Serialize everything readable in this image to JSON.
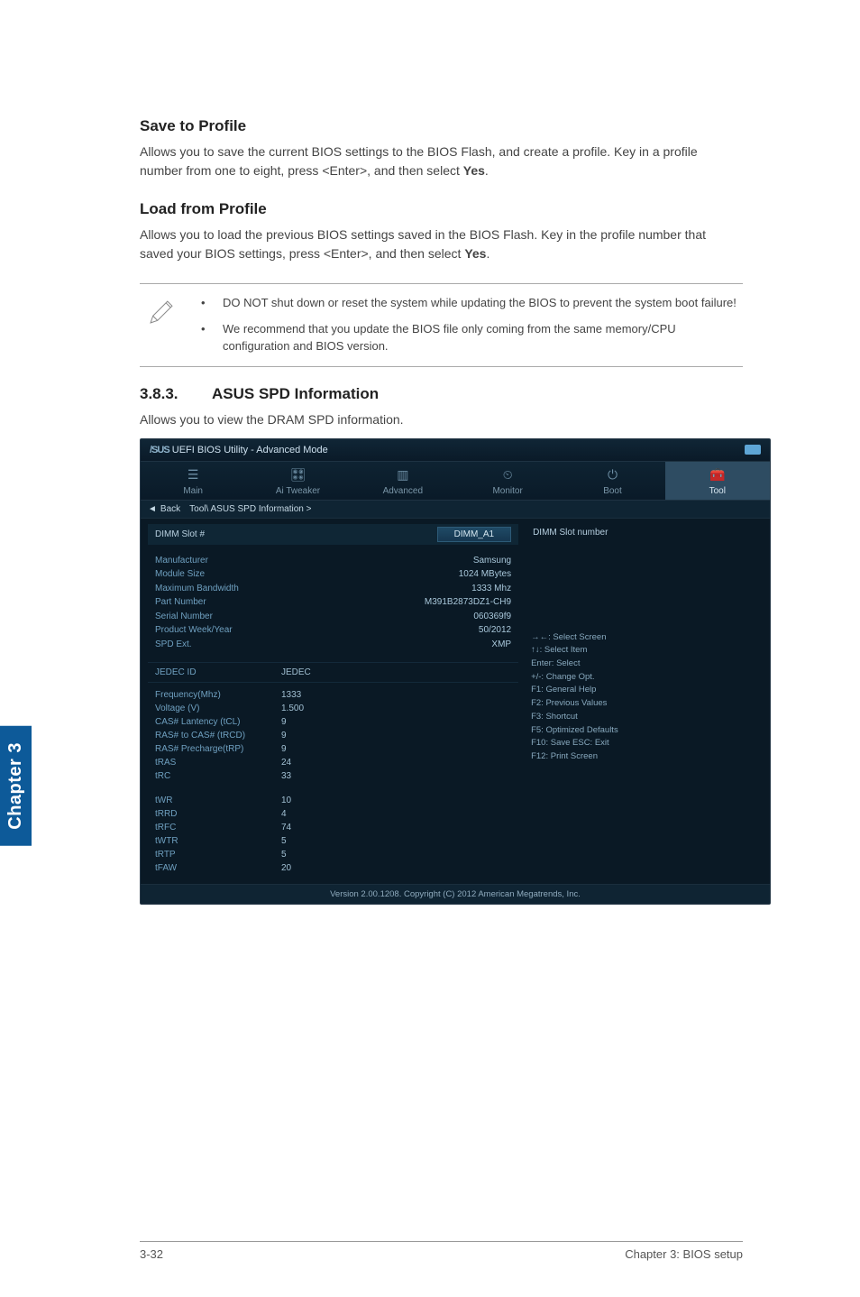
{
  "sideTab": "Chapter 3",
  "saveToProfile": {
    "title": "Save to Profile",
    "body": "Allows you to save the current BIOS settings to the BIOS Flash, and create a profile. Key in a profile number from one to eight, press <Enter>, and then select ",
    "bodyBold": "Yes",
    "bodyEnd": "."
  },
  "loadFromProfile": {
    "title": "Load from Profile",
    "body": "Allows you to load the previous BIOS settings saved in the BIOS Flash. Key in the profile number that saved your BIOS settings, press <Enter>, and then select ",
    "bodyBold": "Yes",
    "bodyEnd": "."
  },
  "notes": [
    "DO NOT shut down or reset the system while updating the BIOS to prevent the system boot failure!",
    "We recommend that you update the BIOS file only coming from the same memory/CPU configuration and BIOS version."
  ],
  "spdSection": {
    "number": "3.8.3.",
    "title": "ASUS SPD Information",
    "body": "Allows you to view the DRAM SPD information."
  },
  "bios": {
    "titleBrand": "/SUS",
    "title": "UEFI BIOS Utility - Advanced Mode",
    "tabs": [
      "Main",
      "Ai Tweaker",
      "Advanced",
      "Monitor",
      "Boot",
      "Tool"
    ],
    "activeTab": 5,
    "backLabel": "Back",
    "breadcrumb": "Tool\\ ASUS SPD Information  >",
    "dimmSlotLabel": "DIMM Slot #",
    "dimmSlotValue": "DIMM_A1",
    "rightTitle": "DIMM Slot number",
    "info": [
      {
        "k": "Manufacturer",
        "v": "Samsung"
      },
      {
        "k": "Module Size",
        "v": "1024 MBytes"
      },
      {
        "k": "Maximum Bandwidth",
        "v": "1333 Mhz"
      },
      {
        "k": "Part Number",
        "v": "M391B2873DZ1-CH9"
      },
      {
        "k": "Serial Number",
        "v": "060369f9"
      },
      {
        "k": "Product Week/Year",
        "v": "50/2012"
      },
      {
        "k": "SPD Ext.",
        "v": "XMP"
      }
    ],
    "jedec": {
      "label": "JEDEC ID",
      "value": "JEDEC"
    },
    "vals1": [
      {
        "k": "Frequency(Mhz)",
        "v": "1333"
      },
      {
        "k": "Voltage (V)",
        "v": "1.500"
      },
      {
        "k": "CAS# Lantency (tCL)",
        "v": "9"
      },
      {
        "k": "RAS# to CAS# (tRCD)",
        "v": "9"
      },
      {
        "k": "RAS# Precharge(tRP)",
        "v": "9"
      },
      {
        "k": "tRAS",
        "v": "24"
      },
      {
        "k": "tRC",
        "v": "33"
      }
    ],
    "vals2": [
      {
        "k": "tWR",
        "v": "10"
      },
      {
        "k": "tRRD",
        "v": "4"
      },
      {
        "k": "tRFC",
        "v": "74"
      },
      {
        "k": "tWTR",
        "v": "5"
      },
      {
        "k": "tRTP",
        "v": "5"
      },
      {
        "k": "tFAW",
        "v": "20"
      }
    ],
    "help": [
      "→←: Select Screen",
      "↑↓: Select Item",
      "Enter: Select",
      "+/-: Change Opt.",
      "F1: General Help",
      "F2: Previous Values",
      "F3: Shortcut",
      "F5: Optimized Defaults",
      "F10: Save   ESC: Exit",
      "F12: Print Screen"
    ],
    "footer": "Version 2.00.1208.   Copyright (C) 2012 American Megatrends, Inc."
  },
  "pageFooter": {
    "left": "3-32",
    "right": "Chapter 3: BIOS setup"
  }
}
